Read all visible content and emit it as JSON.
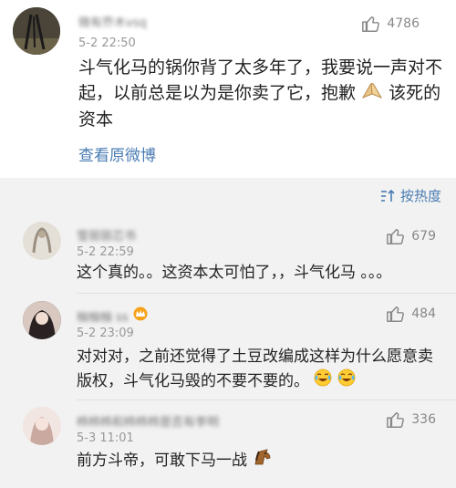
{
  "main_post": {
    "username": "微有乔木vsq",
    "time": "5-2 22:50",
    "likes": "4786",
    "text_before_emoji": "斗气化马的锅你背了太多年了，我要说一声对不起，以前总是以为是你卖了它，抱歉",
    "text_after_emoji": "该死的资本",
    "view_original": "查看原微博"
  },
  "sort": {
    "label": "按热度"
  },
  "comments": [
    {
      "username": "雪丽丽芯书",
      "time": "5-2 22:59",
      "likes": "679",
      "text": "这个真的。。这资本太可怕了，，斗气化马 。。。"
    },
    {
      "username": "柚柚柚 ss",
      "time": "5-2 23:09",
      "likes": "484",
      "text_before_emoji": "对对对，之前还觉得了土豆改编成这样为什么愿意卖版权，斗气化马毁的不要不要的。"
    },
    {
      "username": "柿柿柿和柿柿柿是否有李明",
      "time": "5-3 11:01",
      "likes": "336",
      "text": "前方斗帝，可敢下马一战"
    }
  ],
  "icons": {
    "like": "thumbs-up-icon",
    "sort": "sort-icon",
    "pray_emoji": "praying-hands-emoji",
    "laugh_emoji": "laughing-tears-emoji",
    "horse_emoji": "horse-emoji",
    "vip_badge": "vip-crown-badge"
  },
  "colors": {
    "link": "#4a7cb3",
    "text": "#222222",
    "meta": "#999999",
    "background": "#f2f2f2"
  }
}
